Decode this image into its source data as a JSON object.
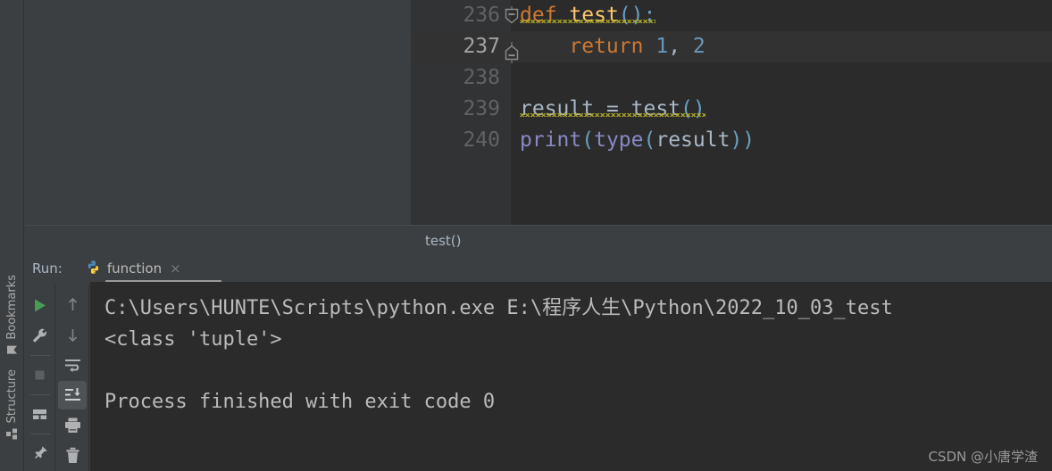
{
  "editor": {
    "breadcrumb": "test()",
    "lines": [
      {
        "number": "236",
        "current": false,
        "fold": "collapse",
        "tokens": [
          {
            "text": "def",
            "kind": "kw"
          },
          {
            "text": " ",
            "kind": "op"
          },
          {
            "text": "test",
            "kind": "fn"
          },
          {
            "text": "()",
            "kind": "punc"
          },
          {
            "text": ":",
            "kind": "punc"
          }
        ],
        "warning": true
      },
      {
        "number": "237",
        "current": true,
        "fold": "end",
        "tokens": [
          {
            "text": "    ",
            "kind": "op"
          },
          {
            "text": "return",
            "kind": "kw"
          },
          {
            "text": " ",
            "kind": "op"
          },
          {
            "text": "1",
            "kind": "num"
          },
          {
            "text": ", ",
            "kind": "op"
          },
          {
            "text": "2",
            "kind": "num"
          }
        ],
        "warning": false
      },
      {
        "number": "238",
        "current": false,
        "fold": "",
        "tokens": [],
        "warning": false
      },
      {
        "number": "239",
        "current": false,
        "fold": "",
        "tokens": [
          {
            "text": "result",
            "kind": "ident"
          },
          {
            "text": " = ",
            "kind": "op"
          },
          {
            "text": "test",
            "kind": "ident"
          },
          {
            "text": "()",
            "kind": "punc"
          }
        ],
        "warning": true
      },
      {
        "number": "240",
        "current": false,
        "fold": "",
        "tokens": [
          {
            "text": "print",
            "kind": "builtin"
          },
          {
            "text": "(",
            "kind": "punc"
          },
          {
            "text": "type",
            "kind": "builtin"
          },
          {
            "text": "(",
            "kind": "punc"
          },
          {
            "text": "result",
            "kind": "ident"
          },
          {
            "text": "))",
            "kind": "punc"
          }
        ],
        "warning": false
      }
    ]
  },
  "sidebar": {
    "bookmarks_label": "Bookmarks",
    "structure_label": "Structure"
  },
  "run_panel": {
    "label": "Run:",
    "tab_name": "function",
    "tab_close": "×",
    "toolbar_left": [
      {
        "name": "run-button",
        "icon": "play-icon"
      },
      {
        "name": "settings-button",
        "icon": "wrench-icon"
      },
      {
        "name": "stop-button",
        "icon": "stop-icon"
      },
      {
        "name": "layout-button",
        "icon": "layout-icon"
      },
      {
        "name": "pin-button",
        "icon": "pin-icon"
      }
    ],
    "toolbar_right": [
      {
        "name": "prev-occurrence-button",
        "icon": "arrow-up-icon"
      },
      {
        "name": "next-occurrence-button",
        "icon": "arrow-down-icon"
      },
      {
        "name": "soft-wrap-button",
        "icon": "soft-wrap-icon"
      },
      {
        "name": "scroll-to-end-button",
        "icon": "scroll-end-icon"
      },
      {
        "name": "print-button",
        "icon": "printer-icon"
      },
      {
        "name": "clear-all-button",
        "icon": "trash-icon"
      }
    ],
    "console_lines": [
      "C:\\Users\\HUNTE\\Scripts\\python.exe E:\\程序人生\\Python\\2022_10_03_test",
      "<class 'tuple'>",
      "",
      "Process finished with exit code 0"
    ]
  },
  "watermark": "CSDN @小唐学渣",
  "colors": {
    "panel_bg": "#3c3f41",
    "editor_bg": "#2b2b2b",
    "gutter_bg": "#313335",
    "current_line": "#323232",
    "keyword": "#cc7832",
    "function": "#ffc66d",
    "number": "#6897bb",
    "identifier": "#a9b7c6",
    "builtin": "#8888c6",
    "warning_squiggle": "#bbb529",
    "run_green": "#499c54",
    "console_text": "#bbbbbb"
  }
}
